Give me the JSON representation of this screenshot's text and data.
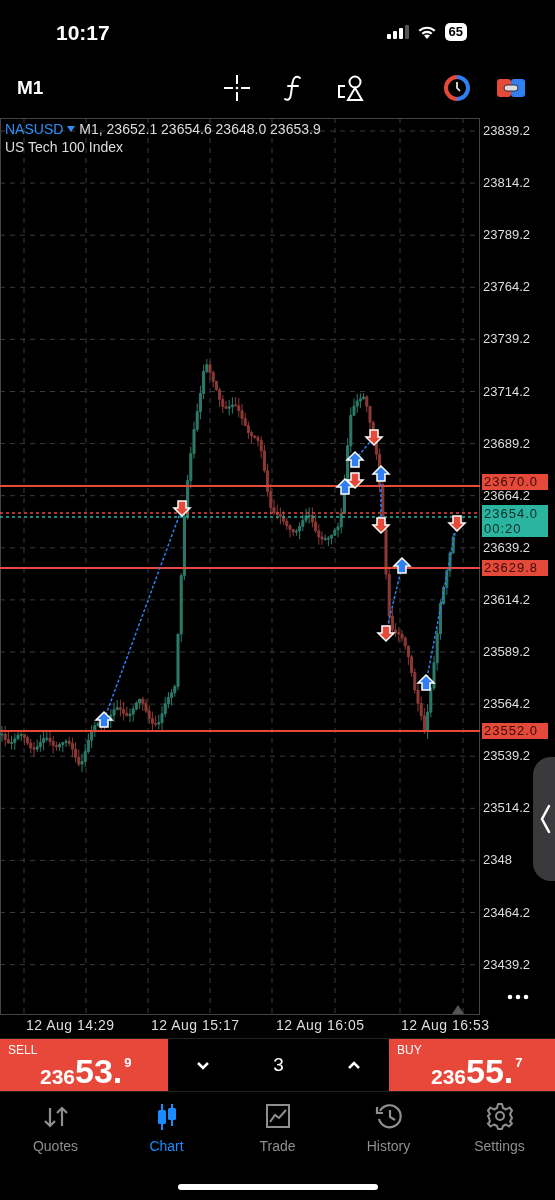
{
  "status_bar": {
    "time": "10:17",
    "battery": "65"
  },
  "toolbar": {
    "timeframe": "M1"
  },
  "chart": {
    "symbol": "NASUSD",
    "info": "M1, 23652.1 23654.6 23648.0 23653.9",
    "description": "US Tech 100 Index",
    "price_axis": [
      "23839.2",
      "23814.2",
      "23789.2",
      "23764.2",
      "23739.2",
      "23714.2",
      "23689.2",
      "23664.2",
      "23639.2",
      "23614.2",
      "23589.2",
      "23564.2",
      "23539.2",
      "23514.2",
      "2348",
      "23464.2",
      "23439.2"
    ],
    "price_lines": [
      {
        "kind": "level",
        "label": "23670.0"
      },
      {
        "kind": "current",
        "label": "23654.0",
        "countdown": "00:20"
      },
      {
        "kind": "level",
        "label": "23629.8"
      },
      {
        "kind": "level",
        "label": "23552.0"
      }
    ],
    "time_axis": [
      "12 Aug 14:29",
      "12 Aug 15:17",
      "12 Aug 16:05",
      "12 Aug 16:53"
    ]
  },
  "trade_bar": {
    "sell": {
      "label": "SELL",
      "prefix": "236",
      "big": "53.",
      "sup": "9"
    },
    "volume": "3",
    "buy": {
      "label": "BUY",
      "prefix": "236",
      "big": "55.",
      "sup": "7"
    }
  },
  "tabs": [
    {
      "label": "Quotes",
      "selected": false
    },
    {
      "label": "Chart",
      "selected": true
    },
    {
      "label": "Trade",
      "selected": false
    },
    {
      "label": "History",
      "selected": false
    },
    {
      "label": "Settings",
      "selected": false
    }
  ]
}
